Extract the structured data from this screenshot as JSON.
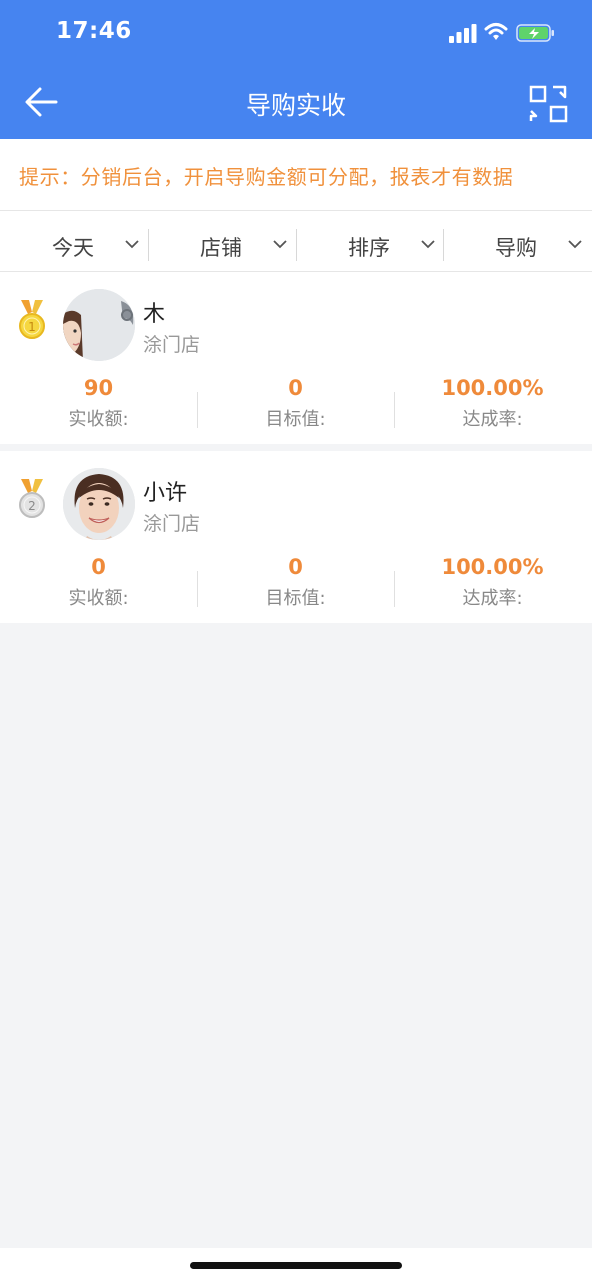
{
  "status_bar": {
    "time": "17:46"
  },
  "nav": {
    "title": "导购实收"
  },
  "tip": {
    "text": "提示：分销后台，开启导购金额可分配，报表才有数据"
  },
  "filters": [
    {
      "label": "今天"
    },
    {
      "label": "店铺"
    },
    {
      "label": "排序"
    },
    {
      "label": "导购"
    }
  ],
  "ranking": [
    {
      "rank": 1,
      "name": "木",
      "store": "涂门店",
      "stats": {
        "received": "90",
        "target": "0",
        "rate": "100.00%"
      },
      "labels": {
        "received": "实收额:",
        "target": "目标值:",
        "rate": "达成率:"
      }
    },
    {
      "rank": 2,
      "name": "小许",
      "store": "涂门店",
      "stats": {
        "received": "0",
        "target": "0",
        "rate": "100.00%"
      },
      "labels": {
        "received": "实收额:",
        "target": "目标值:",
        "rate": "达成率:"
      }
    }
  ],
  "colors": {
    "header": "#4684f0",
    "accent": "#ef8a3a",
    "tip": "#f0913c"
  }
}
